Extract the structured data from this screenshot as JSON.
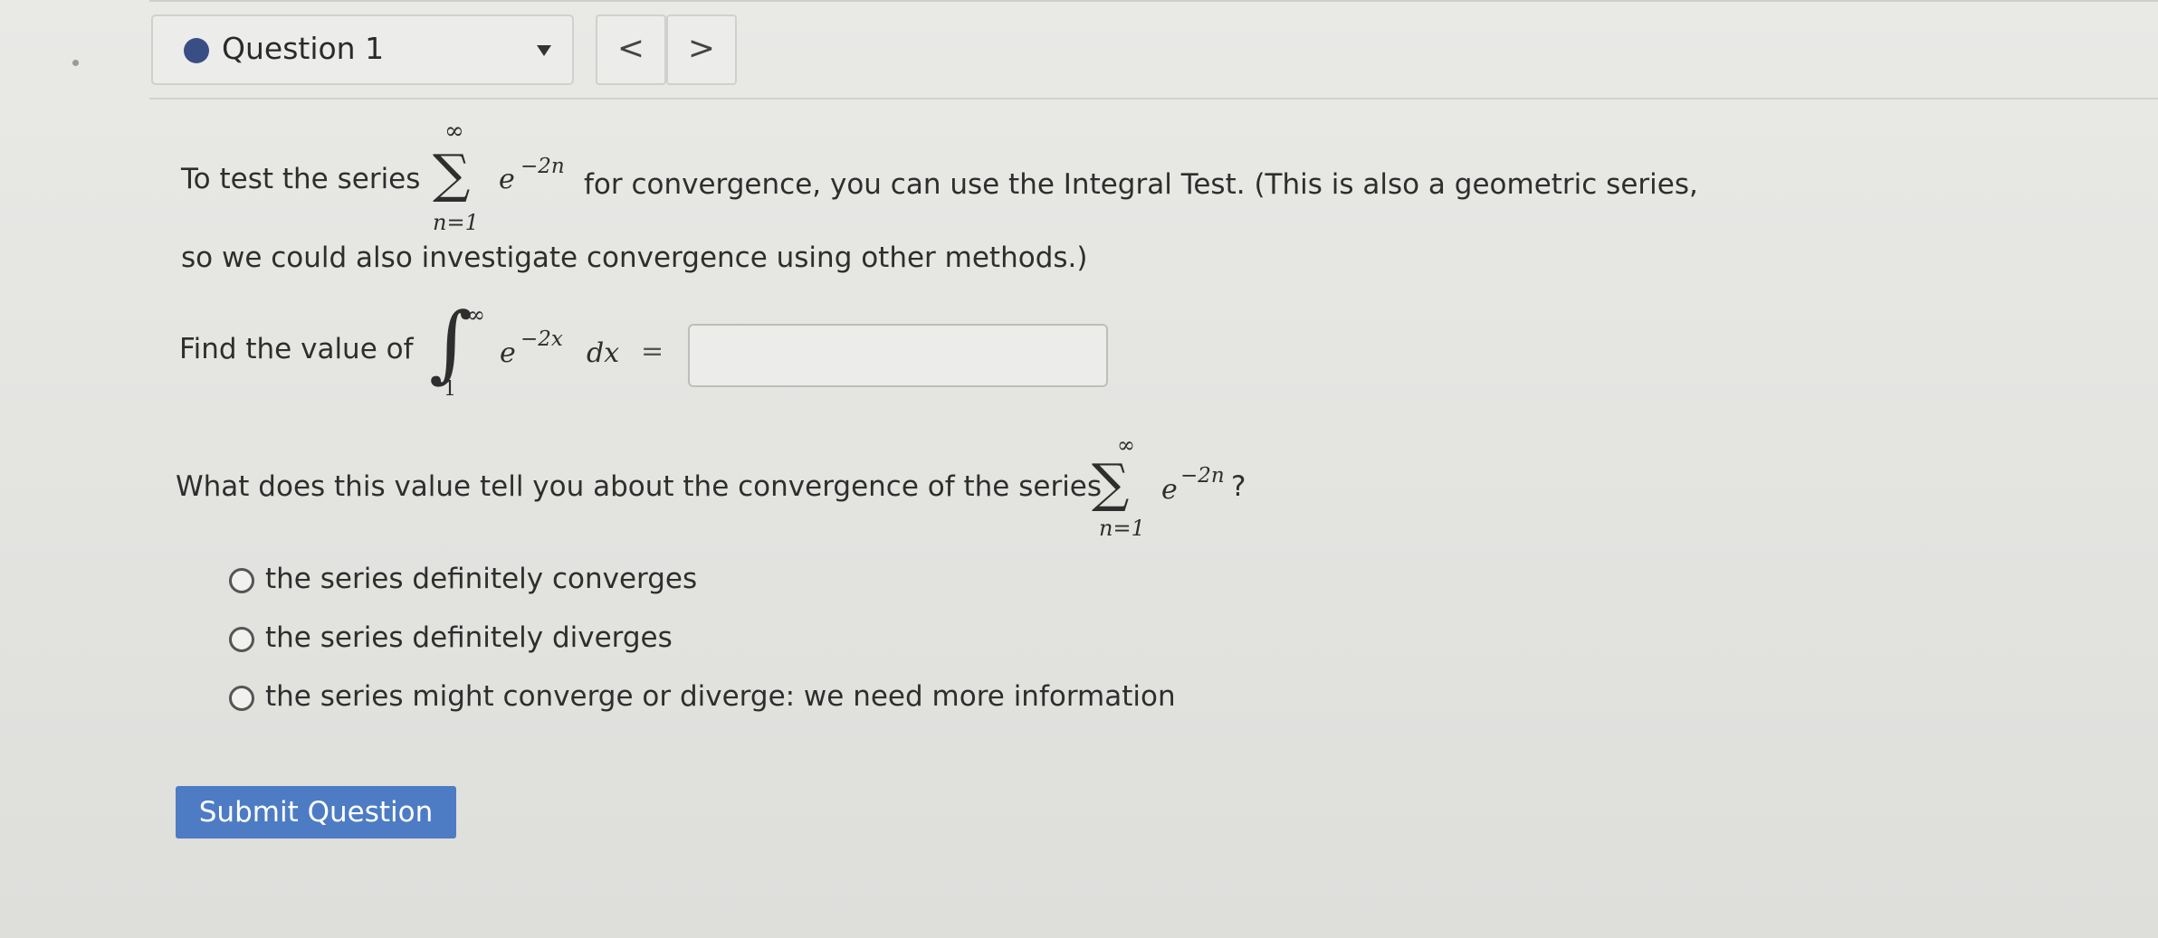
{
  "header": {
    "question_label": "Question 1",
    "prev_label": "<",
    "next_label": ">"
  },
  "question": {
    "intro_before": "To test the series",
    "series_term": "e",
    "series_exponent": "−2n",
    "sum_upper": "∞",
    "sum_lower": "n=1",
    "intro_after": "for convergence, you can use the Integral Test. (This is also a geometric series,",
    "intro_line2": "so we could also investigate convergence using other methods.)",
    "find_label": "Find the value of",
    "integral_upper": "∞",
    "integral_lower": "1",
    "integrand_base": "e",
    "integrand_exponent": "−2x",
    "integrand_dx": "dx",
    "equals": "=",
    "answer_value": "",
    "followup_before": "What does this value tell you about the convergence of the series",
    "followup_term": "e",
    "followup_exponent": "−2n",
    "followup_end": "?",
    "followup_sum_upper": "∞",
    "followup_sum_lower": "n=1"
  },
  "options": [
    {
      "label": "the series definitely converges",
      "selected": false
    },
    {
      "label": "the series definitely diverges",
      "selected": false
    },
    {
      "label": "the series might converge or diverge: we need more information",
      "selected": false
    }
  ],
  "submit_label": "Submit Question",
  "colors": {
    "accent": "#4d7cc4",
    "question_dot": "#3a4e86",
    "background": "#e6e6e3"
  }
}
